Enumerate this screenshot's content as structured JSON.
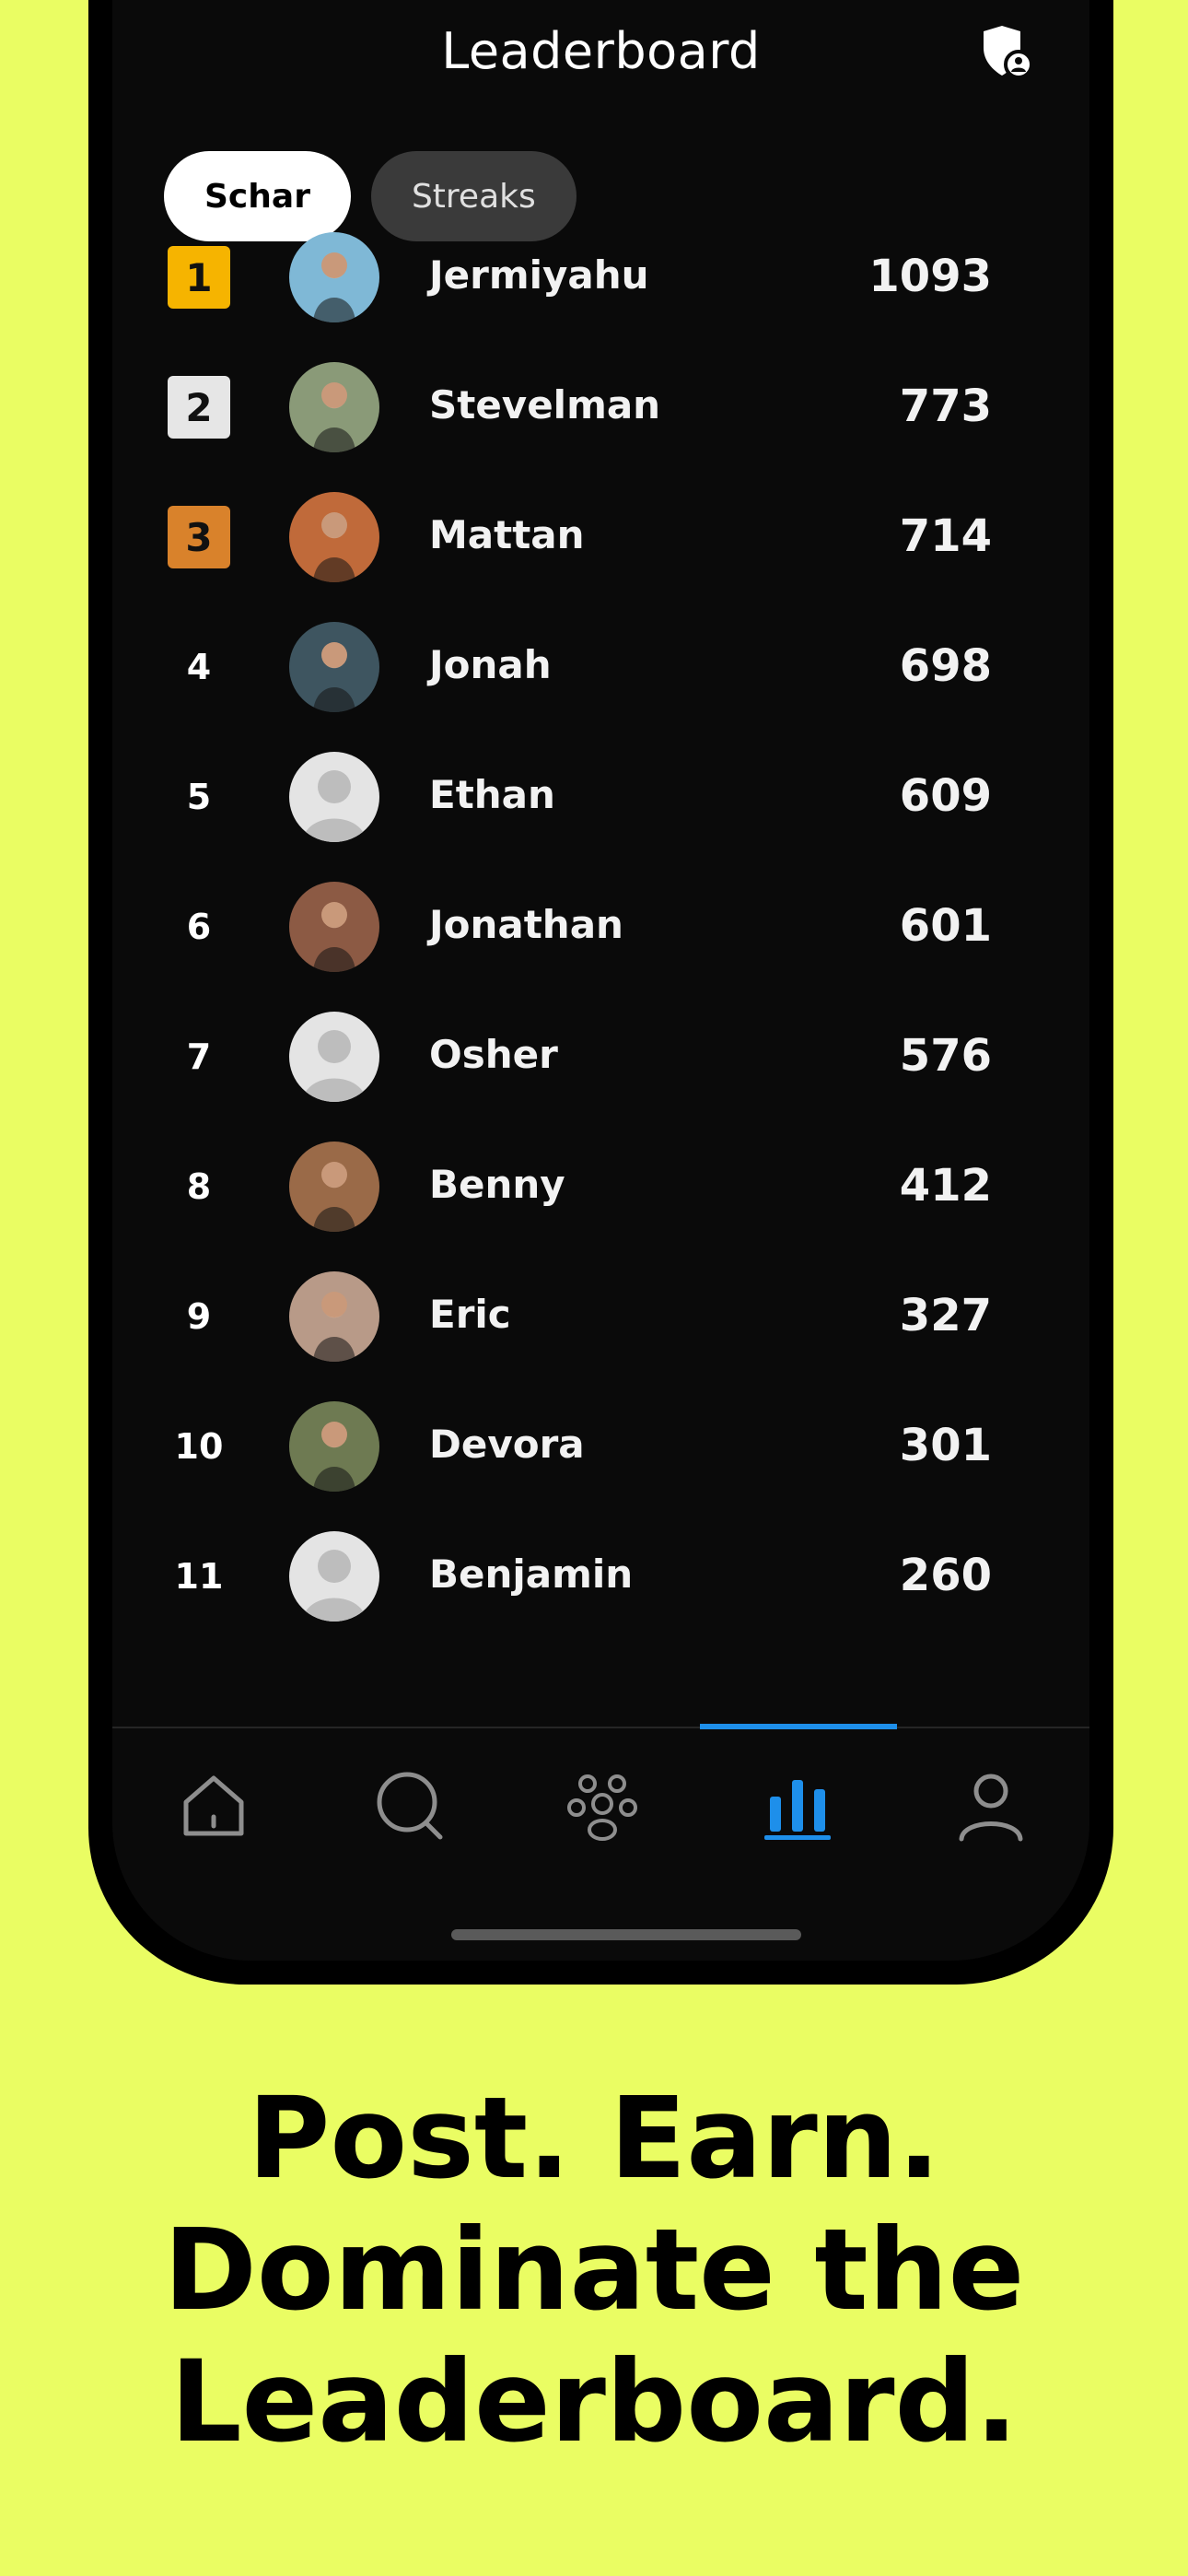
{
  "header": {
    "title": "Leaderboard",
    "shield_icon": "shield-user-icon"
  },
  "tabs": [
    {
      "label": "Schar",
      "active": true
    },
    {
      "label": "Streaks",
      "active": false
    }
  ],
  "leaderboard": [
    {
      "rank": "1",
      "name": "Jermiyahu",
      "score": "1093",
      "badge_color": "#F6B400",
      "avatar_color": "#7FB8D6"
    },
    {
      "rank": "2",
      "name": "Stevelman",
      "score": "773",
      "badge_color": "#E6E6E6",
      "avatar_color": "#8A9A78"
    },
    {
      "rank": "3",
      "name": "Mattan",
      "score": "714",
      "badge_color": "#D9822B",
      "avatar_color": "#C06A3A"
    },
    {
      "rank": "4",
      "name": "Jonah",
      "score": "698",
      "avatar_color": "#3E5560"
    },
    {
      "rank": "5",
      "name": "Ethan",
      "score": "609",
      "avatar_color": "placeholder"
    },
    {
      "rank": "6",
      "name": "Jonathan",
      "score": "601",
      "avatar_color": "#8C5A44"
    },
    {
      "rank": "7",
      "name": "Osher",
      "score": "576",
      "avatar_color": "placeholder"
    },
    {
      "rank": "8",
      "name": "Benny",
      "score": "412",
      "avatar_color": "#9A6A48"
    },
    {
      "rank": "9",
      "name": "Eric",
      "score": "327",
      "avatar_color": "#B89A88"
    },
    {
      "rank": "10",
      "name": "Devora",
      "score": "301",
      "avatar_color": "#6E7A52"
    },
    {
      "rank": "11",
      "name": "Benjamin",
      "score": "260",
      "avatar_color": "placeholder"
    }
  ],
  "nav": [
    {
      "icon": "home-icon",
      "active": false
    },
    {
      "icon": "search-icon",
      "active": false
    },
    {
      "icon": "community-icon",
      "active": false
    },
    {
      "icon": "leaderboard-icon",
      "active": true
    },
    {
      "icon": "profile-icon",
      "active": false
    }
  ],
  "colors": {
    "background": "#EAFD63",
    "accent": "#1E8FEA",
    "screen": "#0A0A0A"
  },
  "tagline": {
    "line1": "Post. Earn.",
    "line2": "Dominate the",
    "line3": "Leaderboard."
  }
}
